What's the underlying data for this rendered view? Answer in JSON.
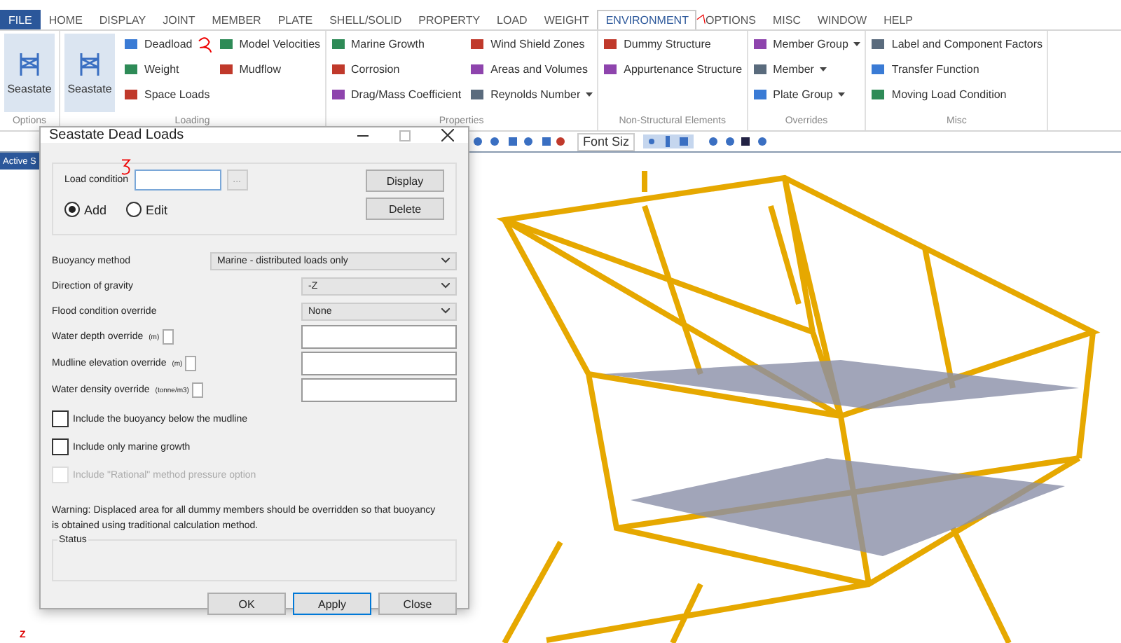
{
  "ribbon_tabs": [
    {
      "label": "FILE",
      "kind": "file",
      "selected": false
    },
    {
      "label": "HOME",
      "kind": "tab",
      "selected": false
    },
    {
      "label": "DISPLAY",
      "kind": "tab",
      "selected": false
    },
    {
      "label": "JOINT",
      "kind": "tab",
      "selected": false
    },
    {
      "label": "MEMBER",
      "kind": "tab",
      "selected": false
    },
    {
      "label": "PLATE",
      "kind": "tab",
      "selected": false
    },
    {
      "label": "SHELL/SOLID",
      "kind": "tab",
      "selected": false
    },
    {
      "label": "PROPERTY",
      "kind": "tab",
      "selected": false
    },
    {
      "label": "LOAD",
      "kind": "tab",
      "selected": false
    },
    {
      "label": "WEIGHT",
      "kind": "tab",
      "selected": false
    },
    {
      "label": "ENVIRONMENT",
      "kind": "tab",
      "selected": true
    },
    {
      "label": "OPTIONS",
      "kind": "tab",
      "selected": false
    },
    {
      "label": "MISC",
      "kind": "tab",
      "selected": false
    },
    {
      "label": "WINDOW",
      "kind": "tab",
      "selected": false
    },
    {
      "label": "HELP",
      "kind": "tab",
      "selected": false
    }
  ],
  "ribbon_groups": [
    {
      "label": "Options",
      "large": [
        {
          "label": "Seastate"
        }
      ]
    },
    {
      "label": "Loading",
      "large": [
        {
          "label": "Seastate"
        }
      ],
      "columns": [
        [
          {
            "label": "Deadload",
            "dropdown": false
          },
          {
            "label": "Weight",
            "dropdown": false
          },
          {
            "label": "Space Loads",
            "dropdown": false
          }
        ],
        [
          {
            "label": "Model Velocities",
            "dropdown": false
          },
          {
            "label": "Mudflow",
            "dropdown": false
          }
        ]
      ]
    },
    {
      "label": "Properties",
      "columns": [
        [
          {
            "label": "Marine Growth",
            "dropdown": false
          },
          {
            "label": "Corrosion",
            "dropdown": false
          },
          {
            "label": "Drag/Mass Coefficient",
            "dropdown": false
          }
        ],
        [
          {
            "label": "Wind Shield Zones",
            "dropdown": false
          },
          {
            "label": "Areas and Volumes",
            "dropdown": false
          },
          {
            "label": "Reynolds Number",
            "dropdown": true
          }
        ]
      ]
    },
    {
      "label": "Non-Structural Elements",
      "columns": [
        [
          {
            "label": "Dummy Structure",
            "dropdown": false
          },
          {
            "label": "Appurtenance Structure",
            "dropdown": false
          }
        ]
      ]
    },
    {
      "label": "Overrides",
      "columns": [
        [
          {
            "label": "Member Group",
            "dropdown": true
          },
          {
            "label": "Member",
            "dropdown": true
          },
          {
            "label": "Plate Group",
            "dropdown": true
          }
        ]
      ]
    },
    {
      "label": "Misc",
      "columns": [
        [
          {
            "label": "Label and Component Factors",
            "dropdown": false
          },
          {
            "label": "Transfer Function",
            "dropdown": false
          },
          {
            "label": "Moving Load Condition",
            "dropdown": false
          }
        ]
      ]
    }
  ],
  "toolbar": {
    "font_size": "Font Siz"
  },
  "view_tab": "Active S",
  "axis_label": "Z",
  "dialog": {
    "title": "Seastate Dead Loads",
    "load_condition_label": "Load condition",
    "browse": "...",
    "side_buttons": [
      "Display",
      "Delete"
    ],
    "radios": [
      {
        "label": "Add",
        "selected": true
      },
      {
        "label": "Edit",
        "selected": false
      }
    ],
    "fields": [
      {
        "label": "Buoyancy method",
        "kind": "select",
        "value": "Marine - distributed loads only",
        "wide": true
      },
      {
        "label": "Direction of gravity",
        "kind": "select",
        "value": "-Z",
        "wide": false
      },
      {
        "label": "Flood condition override",
        "kind": "select",
        "value": "None",
        "wide": false
      },
      {
        "label": "Water depth override",
        "kind": "input",
        "unit": "(m)"
      },
      {
        "label": "Mudline elevation override",
        "kind": "input",
        "unit": "(m)"
      },
      {
        "label": "Water density override",
        "kind": "input",
        "unit": "(tonne/m3)"
      }
    ],
    "checkboxes": [
      {
        "label": "Include the buoyancy below the mudline",
        "checked": false,
        "disabled": false
      },
      {
        "label": "Include only marine growth",
        "checked": false,
        "disabled": false
      },
      {
        "label": "Include \"Rational\" method pressure option",
        "checked": false,
        "disabled": true
      }
    ],
    "warning": "Warning: Displaced area for all dummy members should be overridden so that buoyancy is obtained using traditional calculation method.",
    "status_label": "Status",
    "buttons": [
      {
        "label": "OK",
        "selected": false
      },
      {
        "label": "Apply",
        "selected": true
      },
      {
        "label": "Close",
        "selected": false
      }
    ]
  }
}
